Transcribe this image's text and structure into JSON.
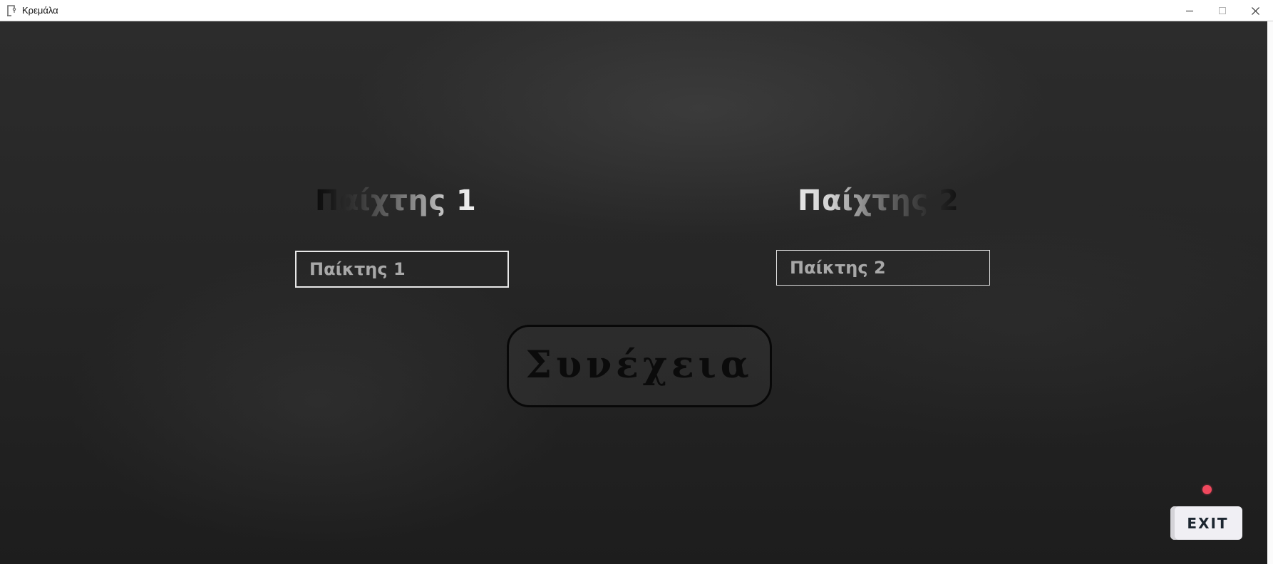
{
  "window": {
    "title": "Κρεμάλα",
    "icon": "gallows-app-icon",
    "controls": {
      "minimize": "minimize-icon",
      "maximize": "maximize-icon",
      "close": "close-icon"
    }
  },
  "players": {
    "player1": {
      "heading": "Παίχτης 1",
      "field_value": "Παίκτης 1"
    },
    "player2": {
      "heading": "Παίχτης 2",
      "field_value": "Παίκτης 2"
    }
  },
  "continue_button": {
    "label": "Συνέχεια"
  },
  "exit_button": {
    "label": "EXIT",
    "indicator_color": "#f0485d"
  },
  "colors": {
    "background": "#262626",
    "field_border": "#e8e8e8",
    "exit_bg": "#f0eff4"
  }
}
